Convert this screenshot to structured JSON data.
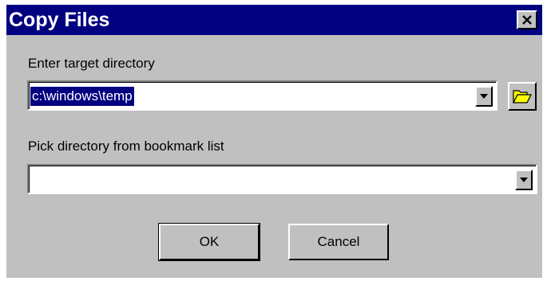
{
  "window": {
    "title": "Copy Files"
  },
  "target": {
    "label": "Enter target directory",
    "value": "c:\\windows\\temp"
  },
  "bookmark": {
    "label": "Pick directory from bookmark list",
    "value": ""
  },
  "buttons": {
    "ok_label": "OK",
    "cancel_label": "Cancel"
  },
  "icons": {
    "close": "close-icon",
    "dropdown": "chevron-down-icon",
    "browse": "folder-open-icon"
  },
  "colors": {
    "titlebar": "#000080",
    "face": "#c0c0c0",
    "selection": "#000080"
  }
}
